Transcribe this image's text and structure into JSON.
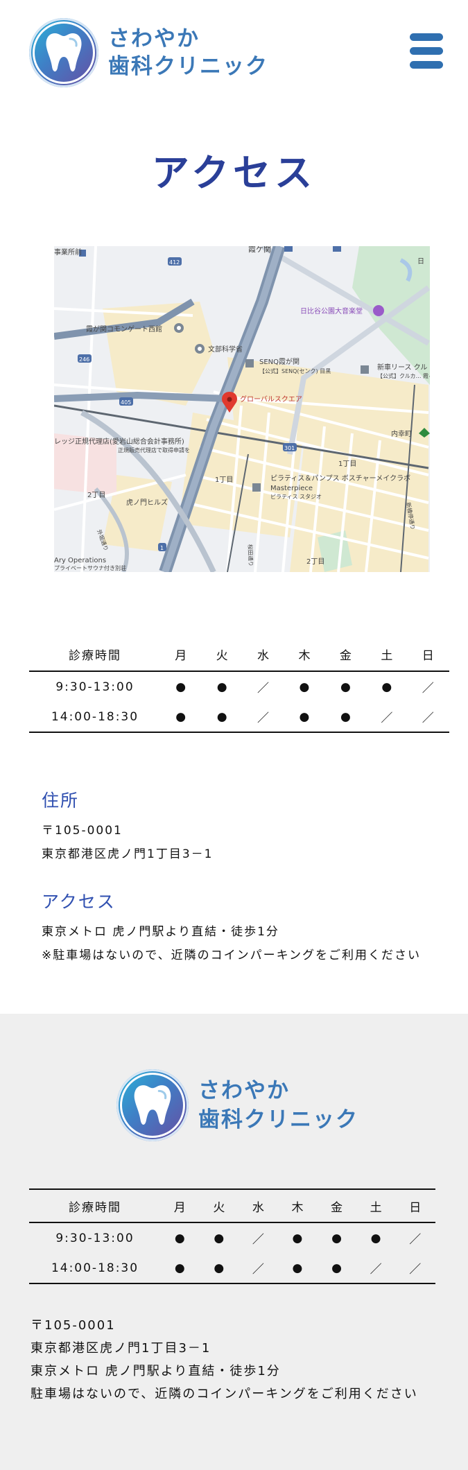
{
  "header": {
    "logo_line1": "さわやか",
    "logo_line2": "歯科クリニック",
    "menu_icon": "hamburger-menu-icon"
  },
  "page_title": "アクセス",
  "map": {
    "labels": {
      "kasumigaseki": "霞ケ関",
      "hibiya_hall": "日比谷公園大音楽堂",
      "commongate": "霞が関コモンゲート西館",
      "monbu": "文部科学省",
      "senq": "SENQ霞が関",
      "senq_sub": "【公式】SENQ(センク) 目黒",
      "shinsha": "新車リース クル",
      "shinsha_sub": "【公式】クルカ… 霞ヶ関",
      "global_square": "グローバルスクエア",
      "uchisaiwai": "内幸町",
      "legal": "レッジ正規代理店(愛岩山総合会計事務所)",
      "legal_sub": "正規販売代理店で取得申請を",
      "ichome_1": "1丁目",
      "ichome_2": "1丁目",
      "nichome_1": "2丁目",
      "nichome_2": "2丁目",
      "pilates": "ピラティス＆パンプス ボスチャーメイクラボ",
      "masterpiece": "Masterpiece",
      "masterpiece_sub": "ピラティス スタジオ",
      "toranomon_hills": "虎ノ門ヒルズ",
      "operations": "Ary Operations",
      "operations_sub": "プライベートサウナ付き別荘",
      "jimusho": "事業所前",
      "rt412": "412",
      "rt246": "246",
      "rt405": "405",
      "rt301": "301",
      "rt1": "1",
      "sotobori": "外堀通り",
      "sakurada": "桜田通り",
      "shinbashi": "新橋停通り",
      "hibiya_label": "日"
    },
    "colors": {
      "land": "#eef0f3",
      "park": "#cfe8d2",
      "block": "#f6ebc9",
      "road": "#ffffff",
      "highway": "#7f93ad",
      "water": "#aac8e8",
      "pin": "#e03a2f"
    }
  },
  "schedule": {
    "header": [
      "診療時間",
      "月",
      "火",
      "水",
      "木",
      "金",
      "土",
      "日"
    ],
    "rows": [
      {
        "time": "9:30-13:00",
        "days": [
          "●",
          "●",
          "／",
          "●",
          "●",
          "●",
          "／"
        ]
      },
      {
        "time": "14:00-18:30",
        "days": [
          "●",
          "●",
          "／",
          "●",
          "●",
          "／",
          "／"
        ]
      }
    ]
  },
  "info": {
    "address_heading": "住所",
    "postal": "〒105-0001",
    "address": "東京都港区虎ノ門1丁目3－1",
    "access_heading": "アクセス",
    "access_line1": "東京メトロ 虎ノ門駅より直結・徒歩1分",
    "access_line2": "※駐車場はないので、近隣のコインパーキングをご利用ください"
  },
  "footer": {
    "logo_line1": "さわやか",
    "logo_line2": "歯科クリニック",
    "postal": "〒105-0001",
    "address": "東京都港区虎ノ門1丁目3－1",
    "access": "東京メトロ 虎ノ門駅より直結・徒歩1分",
    "parking": "駐車場はないので、近隣のコインパーキングをご利用ください",
    "background": "#efefef"
  }
}
